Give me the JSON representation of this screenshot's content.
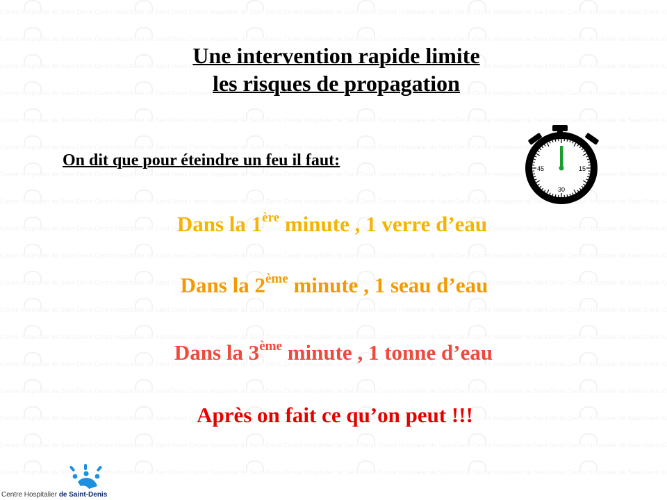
{
  "slide": {
    "title_line1": "Une intervention rapide limite",
    "title_line2": "les risques de propagation",
    "intro": "On dit que pour  éteindre un feu il faut:",
    "lines": [
      {
        "prefix": "Dans la 1",
        "sup": "ère",
        "suffix": " minute , 1 verre d’eau"
      },
      {
        "prefix": "Dans la 2",
        "sup": "ème",
        "suffix": " minute , 1 seau d’eau"
      },
      {
        "prefix": "Dans la 3",
        "sup": "ème",
        "suffix": " minute , 1 tonne d’eau"
      },
      {
        "text": "Après on fait ce qu’on peut !!!"
      }
    ],
    "colors": {
      "line1": "#f4b400",
      "line2": "#f49a00",
      "line3": "#ee4b3d",
      "line4": "#e60000",
      "stopwatch_hand": "#1a9c2e",
      "logo_blue": "#1e90e0"
    }
  },
  "stopwatch": {
    "icon": "stopwatch-icon",
    "labels": [
      "45",
      "15",
      "30"
    ]
  },
  "logo": {
    "icon": "hospital-sun-logo-icon",
    "text_normal": "Centre Hospitalier ",
    "text_bold": "de Saint-Denis"
  },
  "watermark_text": "Centre Hospitalier de Saint-Denis"
}
